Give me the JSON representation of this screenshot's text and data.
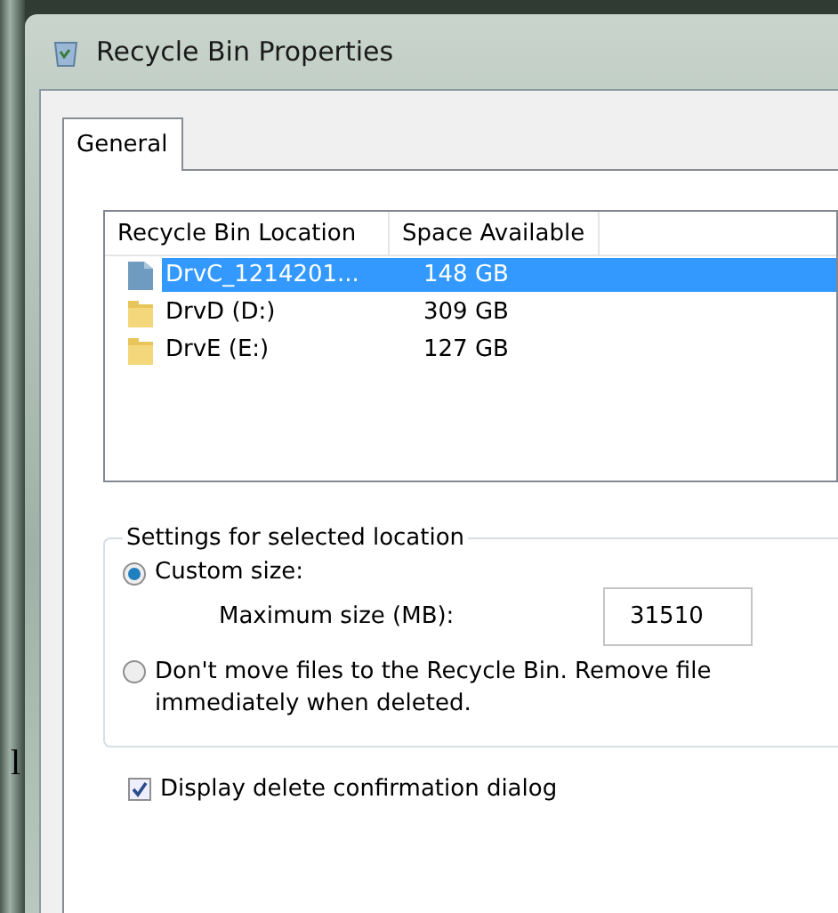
{
  "window": {
    "title": "Recycle Bin Properties"
  },
  "tabs": [
    {
      "label": "General",
      "selected": true
    }
  ],
  "locations": {
    "columns": [
      "Recycle Bin Location",
      "Space Available"
    ],
    "rows": [
      {
        "name": "DrvC_1214201...",
        "space": "148 GB",
        "kind": "drive",
        "selected": true
      },
      {
        "name": "DrvD (D:)",
        "space": "309 GB",
        "kind": "folder",
        "selected": false
      },
      {
        "name": "DrvE (E:)",
        "space": "127 GB",
        "kind": "folder",
        "selected": false
      }
    ]
  },
  "settings": {
    "title": "Settings for selected location",
    "options": [
      {
        "label": "Custom size:",
        "selected": true
      },
      {
        "label": "Don't move files to the Recycle Bin. Remove file\nimmediately when deleted.",
        "selected": false
      }
    ],
    "max_size_label": "Maximum size (MB):",
    "max_size_value": "31510"
  },
  "confirm": {
    "label": "Display delete confirmation dialog",
    "checked": true
  },
  "background_text": "l"
}
